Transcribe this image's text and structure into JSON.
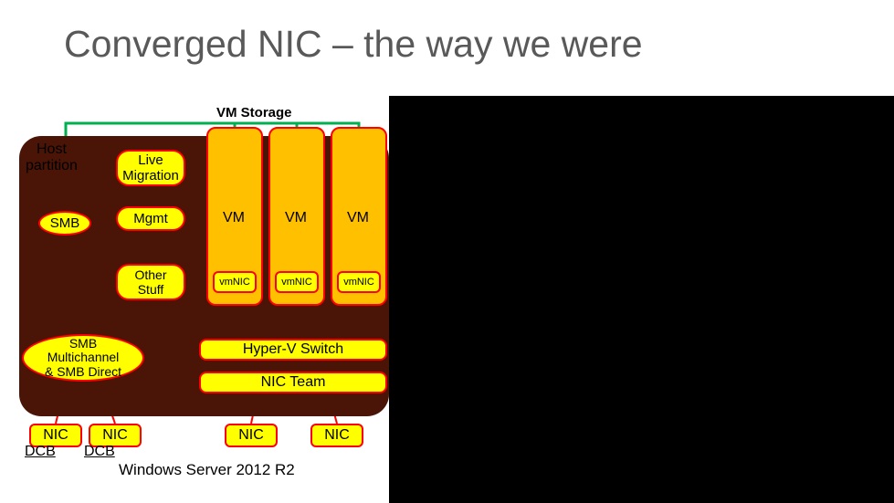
{
  "title": "Converged NIC – the way we were",
  "storage_label": "VM Storage",
  "host_label": "Host\npartition",
  "live_migration": "Live\nMigration",
  "smb": "SMB",
  "mgmt": "Mgmt",
  "other": "Other\nStuff",
  "smb_multi": "SMB\nMultichannel\n& SMB Direct",
  "vms": [
    "VM",
    "VM",
    "VM"
  ],
  "vmnics": [
    "vmNIC",
    "vmNIC",
    "vmNIC"
  ],
  "hvswitch": "Hyper-V Switch",
  "nicteam": "NIC Team",
  "nics": [
    "NIC",
    "NIC",
    "NIC",
    "NIC"
  ],
  "dcb": [
    "DCB",
    "DCB"
  ],
  "caption": "Windows Server 2012 R2"
}
